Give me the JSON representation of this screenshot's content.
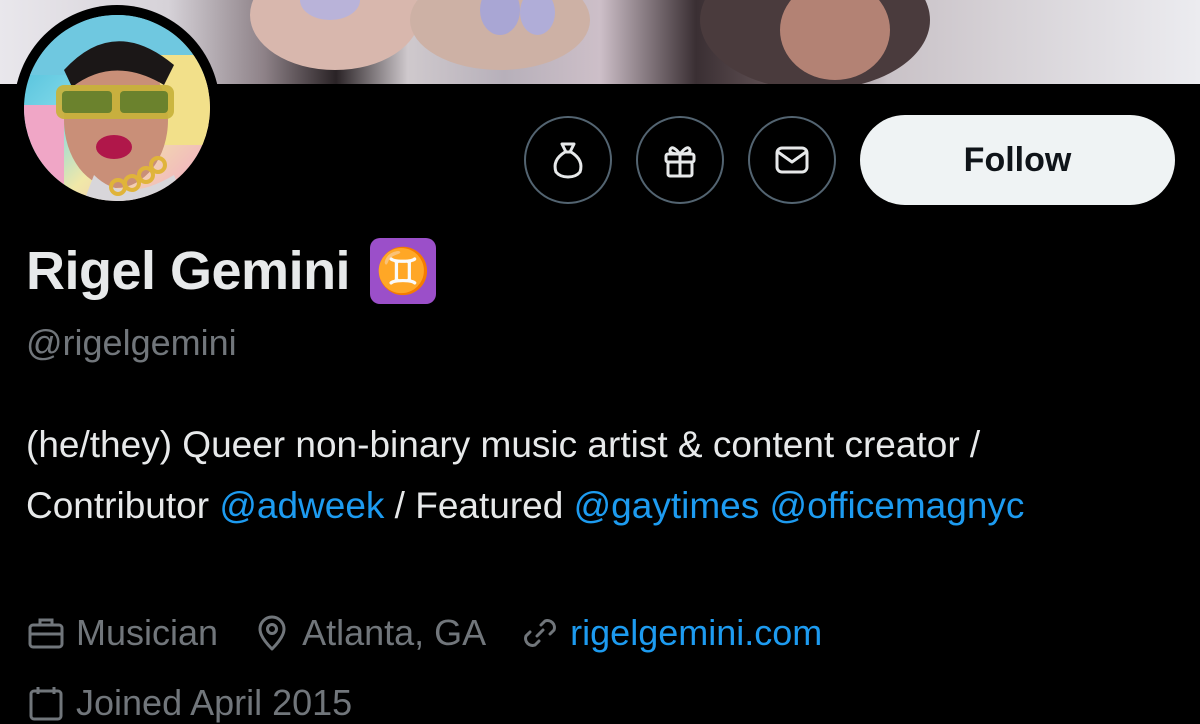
{
  "profile": {
    "display_name": "Rigel Gemini",
    "zodiac_emoji": "♊",
    "handle": "@rigelgemini",
    "bio": {
      "part1": "(he/they) Queer non-binary music artist & content creator / Contributor ",
      "mention1": "@adweek",
      "part2": " / Featured ",
      "mention2": "@gaytimes",
      "part3": " ",
      "mention3": "@officemagnyc"
    },
    "profession": "Musician",
    "location": "Atlanta, GA",
    "website": "rigelgemini.com",
    "joined": "Joined April 2015"
  },
  "actions": {
    "follow_label": "Follow",
    "icons": [
      "money-bag-icon",
      "gift-icon",
      "message-icon"
    ]
  },
  "colors": {
    "background": "#000000",
    "text": "#e7e9ea",
    "secondary": "#71767b",
    "link": "#1d9bf0",
    "follow_bg": "#eff3f4",
    "zodiac_bg": "#9b4fc9"
  }
}
